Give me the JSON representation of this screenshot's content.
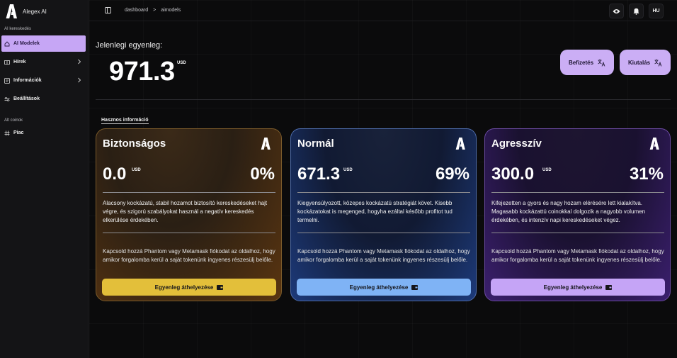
{
  "brand": {
    "name": "Alegex AI",
    "logo_icon": "alegex-logo-icon"
  },
  "sidebar": {
    "section1_label": "AI kereskedés",
    "items": [
      {
        "label": "AI Modelek",
        "icon": "home-icon",
        "active": true
      },
      {
        "label": "Hírek",
        "icon": "book-icon",
        "has_children": true
      },
      {
        "label": "Információk",
        "icon": "info-box-icon",
        "has_children": true
      },
      {
        "label": "Beállítások",
        "icon": "sliders-icon"
      }
    ],
    "section2_label": "Alt coinok",
    "items2": [
      {
        "label": "Piac",
        "icon": "hash-icon"
      }
    ]
  },
  "topbar": {
    "breadcrumb": [
      "dashboard",
      "aimodels"
    ],
    "separator": ">",
    "language": "HU",
    "icons": [
      "sidebar-toggle-icon",
      "eye-icon",
      "bell-icon"
    ]
  },
  "balance": {
    "label": "Jelenlegi egyenleg:",
    "value": "971.3",
    "unit": "USD"
  },
  "actions": {
    "deposit_label": "Befizetés",
    "withdraw_label": "Kiutalás"
  },
  "useful_info_label": "Hasznos információ",
  "cards": [
    {
      "title": "Biztonságos",
      "value": "0.0",
      "unit": "USD",
      "percent": "0%",
      "description": "Alacsony kockázatú, stabil hozamot biztosító kereskedéseket hajt végre, és szigorú szabályokat használ a negatív kereskedés elkerülése érdekében.",
      "note": "Kapcsold hozzá Phantom vagy Metamask fiókodat az oldalhoz, hogy amikor forgalomba kerül a saját tokenünk ingyenes részesülj belőle.",
      "button": "Egyenleg áthelyezése",
      "color": "#e3bf3a"
    },
    {
      "title": "Normál",
      "value": "671.3",
      "unit": "USD",
      "percent": "69%",
      "description": "Kiegyensúlyozott, közepes kockázatú stratégiát követ. Kisebb kockázatokat is megenged, hogyha ezáltal később profitot tud termelni.",
      "note": "Kapcsold hozzá Phantom vagy Metamask fiókodat az oldalhoz, hogy amikor forgalomba kerül a saját tokenünk ingyenes részesülj belőle.",
      "button": "Egyenleg áthelyezése",
      "color": "#7fb3f5"
    },
    {
      "title": "Agresszív",
      "value": "300.0",
      "unit": "USD",
      "percent": "31%",
      "description": "Kifejezetten a gyors és nagy hozam elérésére lett kialakítva. Magasabb kockázattú coinokkal dolgozik a nagyobb volumen érdekében, és intenzív napi kereskedéseket végez.",
      "note": "Kapcsold hozzá Phantom vagy Metamask fiókodat az oldalhoz, hogy amikor forgalomba kerül a saját tokenünk ingyenes részesülj belőle.",
      "button": "Egyenleg áthelyezése",
      "color": "#c5a4f6"
    }
  ]
}
